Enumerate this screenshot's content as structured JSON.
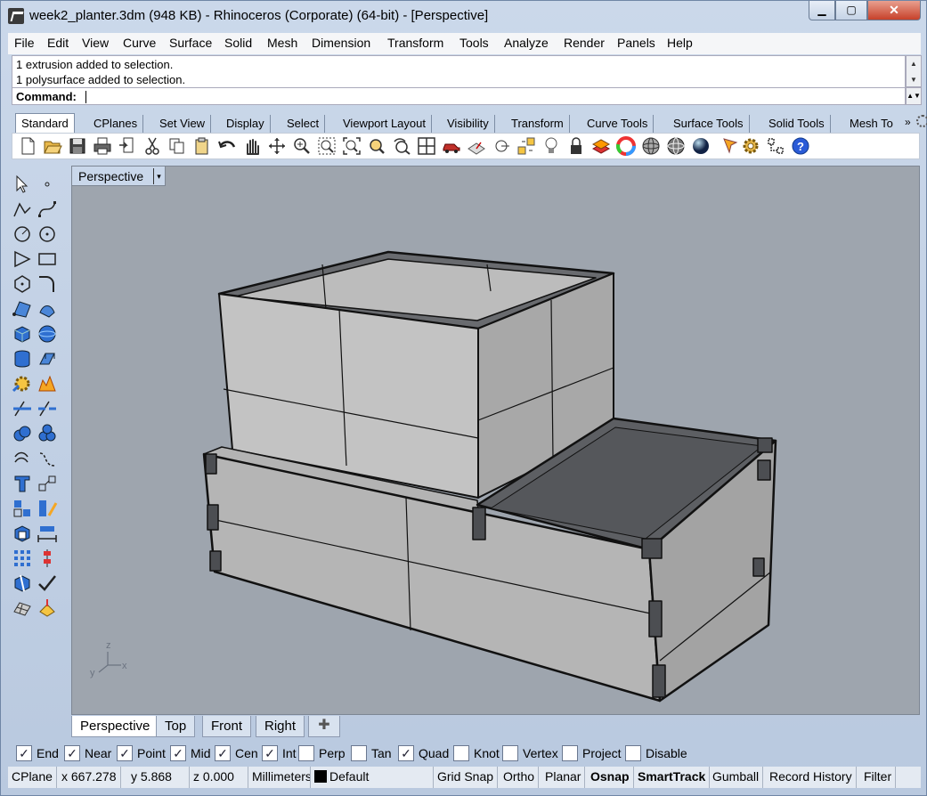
{
  "window": {
    "title": "week2_planter.3dm (948 KB) - Rhinoceros (Corporate) (64-bit) - [Perspective]"
  },
  "menu": [
    "File",
    "Edit",
    "View",
    "Curve",
    "Surface",
    "Solid",
    "Mesh",
    "Dimension",
    "Transform",
    "Tools",
    "Analyze",
    "Render",
    "Panels",
    "Help"
  ],
  "command": {
    "history": [
      "1 extrusion added to selection.",
      "1 polysurface added to selection."
    ],
    "prompt_label": "Command:",
    "value": ""
  },
  "toolbar_tabs": [
    "Standard",
    "CPlanes",
    "Set View",
    "Display",
    "Select",
    "Viewport Layout",
    "Visibility",
    "Transform",
    "Curve Tools",
    "Surface Tools",
    "Solid Tools",
    "Mesh To"
  ],
  "toolbar_tabs_more": "»",
  "toolbar_icons": [
    "new-icon",
    "open-icon",
    "save-icon",
    "print-icon",
    "import-icon",
    "cut-icon",
    "copy-icon",
    "paste-icon",
    "undo-icon",
    "pan-icon",
    "rotate-view-icon",
    "zoom-dynamic-icon",
    "zoom-window-icon",
    "zoom-extents-icon",
    "zoom-selected-icon",
    "undo-view-icon",
    "four-viewports-icon",
    "car-icon",
    "named-cplane-icon",
    "cplane-icon",
    "snap-icon",
    "light-icon",
    "lock-icon",
    "layer-icon",
    "color-wheel-icon",
    "wireframe-sphere-icon",
    "shaded-sphere-icon",
    "rendered-sphere-icon",
    "render-icon",
    "options-gear-icon",
    "grid-snap-icon",
    "help-icon"
  ],
  "left_tools": [
    "select-icon",
    "point-icon",
    "polyline-icon",
    "curve-icon",
    "circle-icon",
    "arc-icon",
    "polygon-icon",
    "rectangle-icon",
    "hexagon-icon",
    "fillet-curve-icon",
    "surface-from-points-icon",
    "edge-surface-icon",
    "box-icon",
    "sphere-icon",
    "cylinder-icon",
    "extrude-surface-icon",
    "explode-icon",
    "boolean-icon",
    "trim-icon",
    "split-icon",
    "boolean-union-icon",
    "boolean-difference-icon",
    "offset-curve-icon",
    "blend-curve-icon",
    "text-icon",
    "move-icon",
    "group-icon",
    "scale-icon",
    "block-icon",
    "dimension-icon",
    "array-icon",
    "align-icon",
    "analyze-icon",
    "check-icon",
    "mesh-icon",
    "paint-icon"
  ],
  "viewport": {
    "label": "Perspective",
    "dropdown": "▾",
    "axis": {
      "x": "x",
      "y": "y",
      "z": "z"
    }
  },
  "viewport_tabs": [
    "Perspective",
    "Top",
    "Front",
    "Right"
  ],
  "viewport_add": "✚",
  "osnaps": [
    {
      "label": "End",
      "checked": true
    },
    {
      "label": "Near",
      "checked": true
    },
    {
      "label": "Point",
      "checked": true
    },
    {
      "label": "Mid",
      "checked": true
    },
    {
      "label": "Cen",
      "checked": true
    },
    {
      "label": "Int",
      "checked": true
    },
    {
      "label": "Perp",
      "checked": false
    },
    {
      "label": "Tan",
      "checked": false
    },
    {
      "label": "Quad",
      "checked": true
    },
    {
      "label": "Knot",
      "checked": false
    },
    {
      "label": "Vertex",
      "checked": false
    },
    {
      "label": "Project",
      "checked": false
    },
    {
      "label": "Disable",
      "checked": false
    }
  ],
  "status": {
    "cplane": "CPlane",
    "x": "x 667.278",
    "y": "y 5.868",
    "z": "z 0.000",
    "units": "Millimeters",
    "layer": "Default",
    "toggles": [
      "Grid Snap",
      "Ortho",
      "Planar",
      "Osnap",
      "SmartTrack",
      "Gumball",
      "Record History",
      "Filter"
    ]
  },
  "colors": {
    "viewport_bg": "#9ea5ae",
    "panel_bg": "#c6d3e6",
    "model_face": "#bdbdbd",
    "model_top": "#595b5e"
  }
}
